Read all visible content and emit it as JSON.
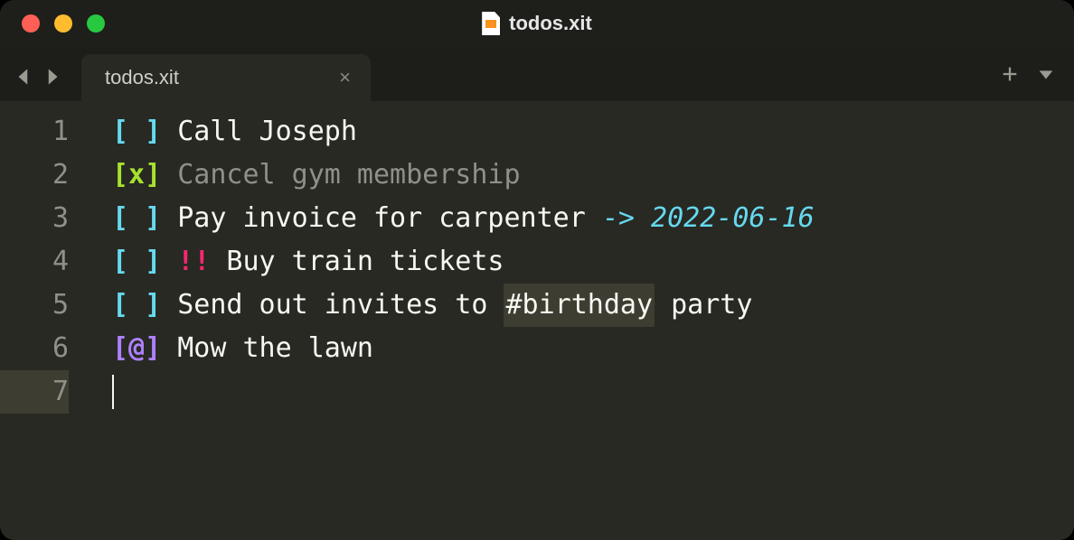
{
  "titlebar": {
    "filename": "todos.xit"
  },
  "tab": {
    "label": "todos.xit",
    "close": "×"
  },
  "gutter": [
    "1",
    "2",
    "3",
    "4",
    "5",
    "6",
    "7"
  ],
  "lines": {
    "l1": {
      "bracket": "[ ]",
      "text": "Call Joseph"
    },
    "l2": {
      "bracket": "[x]",
      "text": "Cancel gym membership"
    },
    "l3": {
      "bracket": "[ ]",
      "text": "Pay invoice for carpenter ",
      "arrow": "-> ",
      "date": "2022-06-16"
    },
    "l4": {
      "bracket": "[ ]",
      "priority": "!!",
      "text": " Buy train tickets"
    },
    "l5": {
      "bracket": "[ ]",
      "pre": "Send out invites to ",
      "tag": "#birthday",
      "post": " party"
    },
    "l6": {
      "bracket": "[@]",
      "text": "Mow the lawn"
    }
  }
}
